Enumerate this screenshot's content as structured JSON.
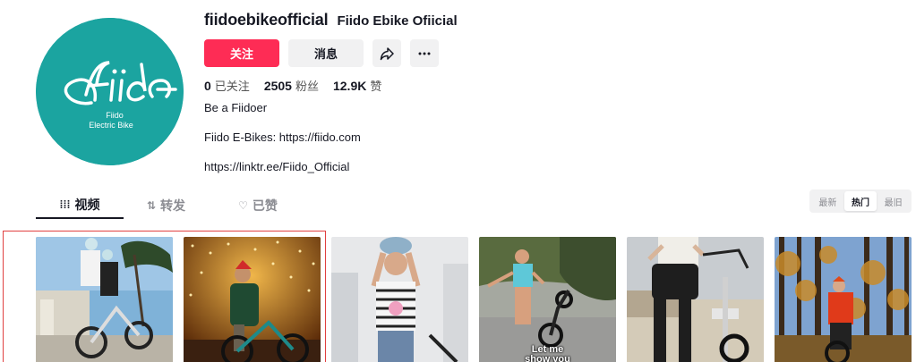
{
  "profile": {
    "username": "fiidoebikeofficial",
    "nickname": "Fiido Ebike Ofiicial",
    "avatar_text_main": "Fiido",
    "avatar_text_sub1": "Fiido",
    "avatar_text_sub2": "Electric Bike",
    "brand_color": "#1ba4a0"
  },
  "actions": {
    "follow_label": "关注",
    "message_label": "消息",
    "share_icon": "share-icon",
    "more_icon": "more-icon",
    "follow_color": "#fe2c55"
  },
  "stats": [
    {
      "value": "0",
      "label": "已关注"
    },
    {
      "value": "2505",
      "label": "粉丝"
    },
    {
      "value": "12.9K",
      "label": "赞"
    }
  ],
  "bio": {
    "line1": "Be a Fiidoer",
    "line2": "Fiido E-Bikes: https://fiido.com",
    "line3": "https://linktr.ee/Fiido_Official"
  },
  "tabs": [
    {
      "label": "视频",
      "icon": "grid-icon",
      "active": true
    },
    {
      "label": "转发",
      "icon": "repost-icon",
      "active": false
    },
    {
      "label": "已赞",
      "icon": "heart-icon",
      "active": false
    }
  ],
  "sort": {
    "options": [
      "最新",
      "热门",
      "最旧"
    ],
    "selected": "热门"
  },
  "videos": [
    {
      "caption": ""
    },
    {
      "caption": ""
    },
    {
      "caption": ""
    },
    {
      "caption": "Let me\nshow you"
    },
    {
      "caption": ""
    },
    {
      "caption": ""
    }
  ]
}
